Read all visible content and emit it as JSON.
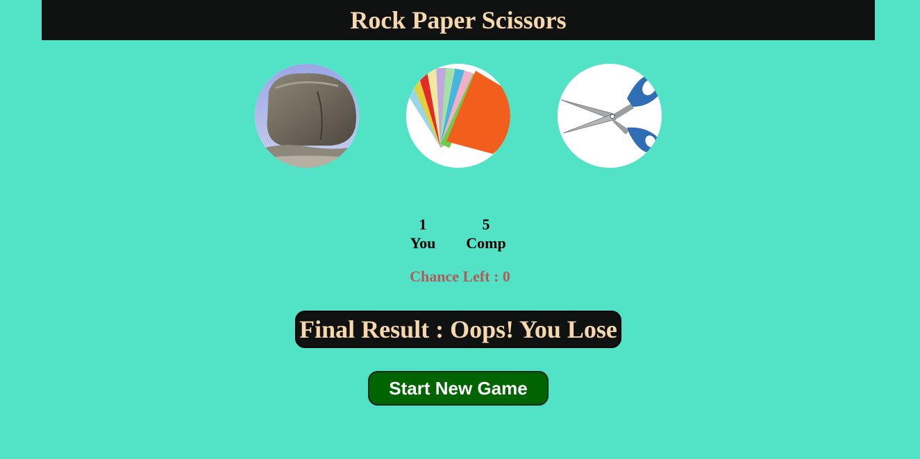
{
  "header": {
    "title": "Rock Paper Scissors"
  },
  "choices": [
    {
      "id": "rock",
      "icon": "rock-icon"
    },
    {
      "id": "paper",
      "icon": "paper-icon"
    },
    {
      "id": "scissors",
      "icon": "scissors-icon"
    }
  ],
  "scoreboard": {
    "user_score": "1",
    "user_label": "You",
    "comp_score": "5",
    "comp_label": "Comp"
  },
  "chances": {
    "label": "Chance Left : ",
    "value": "0"
  },
  "result": {
    "text": "Final Result : Oops! You Lose"
  },
  "controls": {
    "new_game_label": "Start New Game"
  },
  "colors": {
    "background": "#52e3c6",
    "header_bg": "#101211",
    "header_text": "#f7d8ad",
    "chance_text": "#b25a5a",
    "button_bg": "#006400"
  }
}
